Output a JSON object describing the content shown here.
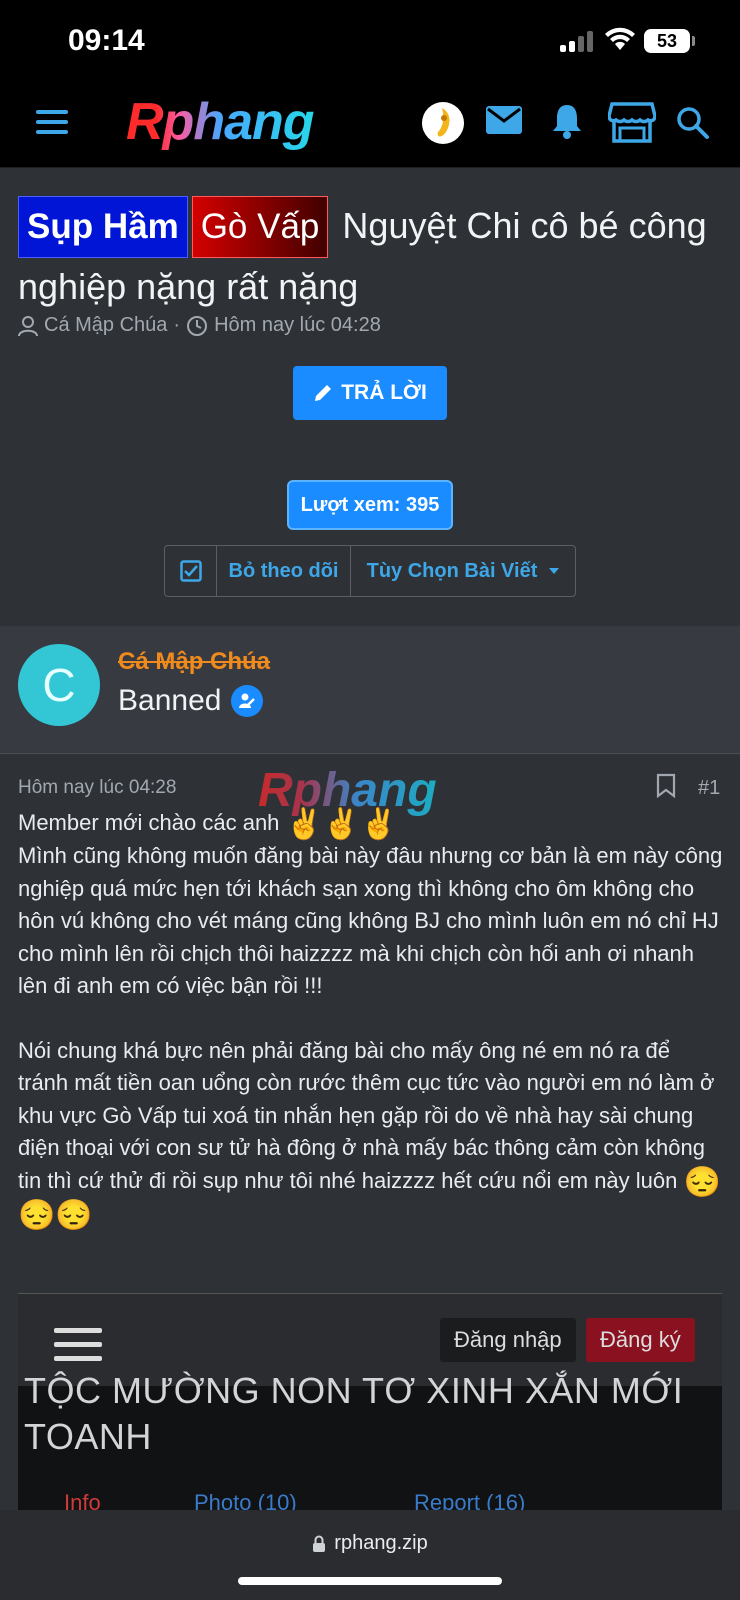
{
  "status": {
    "time": "09:14",
    "battery": "53"
  },
  "header": {
    "logo": "Rphang"
  },
  "thread": {
    "prefix_1": "Sụp Hầm",
    "prefix_2": "Gò Vấp",
    "title": "Nguyệt Chi cô bé công nghiệp nặng rất nặng",
    "author": "Cá Mập Chúa",
    "separator": "·",
    "date": "Hôm nay lúc 04:28",
    "reply_label": "TRẢ LỜI",
    "views_label": "Lượt xem: 395",
    "unwatch_label": "Bỏ theo dõi",
    "options_label": "Tùy Chọn Bài Viết"
  },
  "user": {
    "avatar_letter": "C",
    "name": "Cá Mập Chúa",
    "title": "Banned"
  },
  "post": {
    "date": "Hôm nay lúc 04:28",
    "watermark": "Rphang",
    "number": "#1",
    "line_1": "Member mới chào các anh",
    "line_1_emoji": "✌️✌️✌️",
    "para_1": "Mình cũng không muốn đăng bài này đâu nhưng cơ bản là em này công nghiệp quá mức hẹn tới khách sạn xong thì không cho ôm không cho hôn vú không cho vét máng cũng không BJ cho mình luôn em nó chỉ HJ cho mình lên rồi chịch thôi haizzzz mà khi chịch còn hối anh ơi nhanh lên đi anh em có việc bận rồi !!!",
    "para_2": "Nói chung khá bực nên phải đăng bài cho mấy ông né em nó ra để tránh mất tiền oan uổng còn rước thêm cục tức vào người em nó làm ở khu vực Gò Vấp tui xoá tin nhắn hẹn gặp rồi do về nhà hay sài chung điện thoại với con sư tử hà đông ở nhà mấy bác thông cảm còn không tin thì cứ thử đi rồi sụp như tôi nhé haizzzz hết cứu nổi em này luôn",
    "para_2_emoji": "😔😔😔"
  },
  "embed": {
    "login": "Đăng nhập",
    "register": "Đăng ký",
    "title": "TỘC MƯỜNG NON TƠ XINH XẮN MỚI TOANH",
    "tab_1": "Info",
    "tab_2": "Photo (10)",
    "tab_3": "Report (16)"
  },
  "browser": {
    "url": "rphang.zip"
  },
  "colors": {
    "accent": "#1a8cff",
    "link": "#3ea7e8",
    "username": "#f08a1c",
    "avatar": "#33c7d5"
  }
}
